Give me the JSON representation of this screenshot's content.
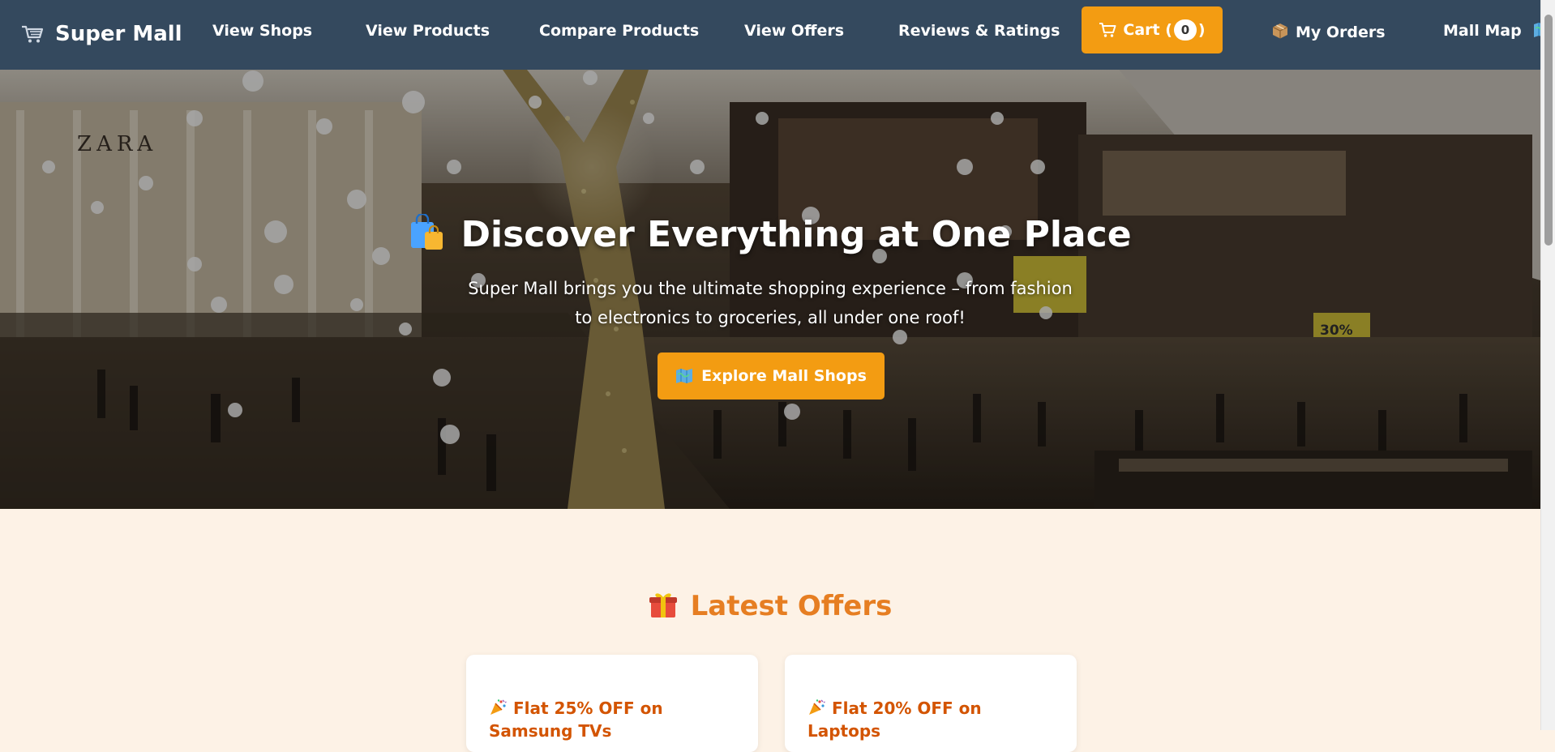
{
  "navbar": {
    "brand": "Super Mall",
    "brand_icon": "shopping-cart-icon",
    "links": {
      "view_shops": "View Shops",
      "view_products": "View Products",
      "compare_products": "Compare Products",
      "view_offers": "View Offers",
      "reviews_ratings": "Reviews & Ratings",
      "my_orders": "My Orders",
      "mall_map": "Mall Map"
    },
    "cart": {
      "label": "Cart (",
      "count": "0",
      "close": ")"
    }
  },
  "hero": {
    "title": "Discover Everything at One Place",
    "subtitle": "Super Mall brings you the ultimate shopping experience – from fashion to electronics to groceries, all under one roof!",
    "button": "Explore Mall Shops"
  },
  "offers": {
    "heading": "Latest Offers",
    "items": [
      {
        "title": "Flat 25% OFF on Samsung TVs"
      },
      {
        "title": "Flat 20% OFF on Laptops"
      }
    ]
  },
  "colors": {
    "navbar": "#34495e",
    "accent": "#f39c12",
    "offers_heading": "#e67e22",
    "offer_title": "#d35400",
    "page_background": "#fdf2e6"
  }
}
